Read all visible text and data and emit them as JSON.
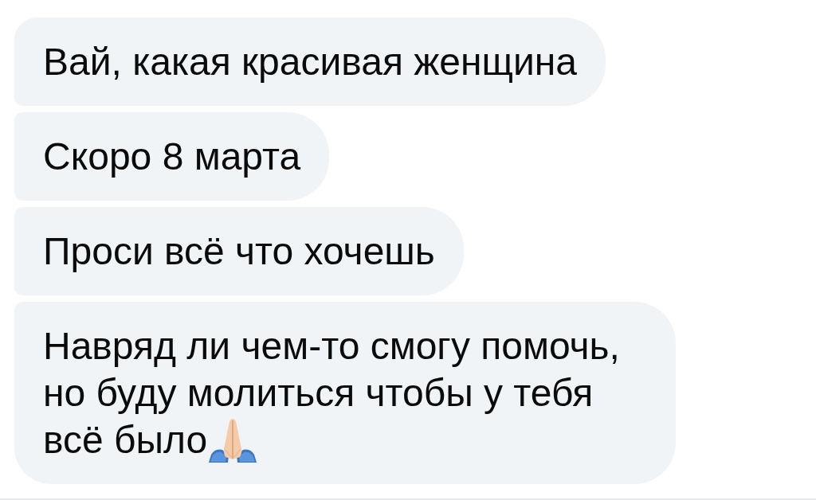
{
  "messages": [
    {
      "text": "Вай, какая красивая женщина",
      "ends_with_icon": false
    },
    {
      "text": "Скоро 8 марта",
      "ends_with_icon": false
    },
    {
      "text": "Проси всё что хочешь",
      "ends_with_icon": false
    },
    {
      "text": "Навряд ли чем-то смогу помочь, но буду молиться чтобы у тебя всё было",
      "ends_with_icon": true
    }
  ]
}
